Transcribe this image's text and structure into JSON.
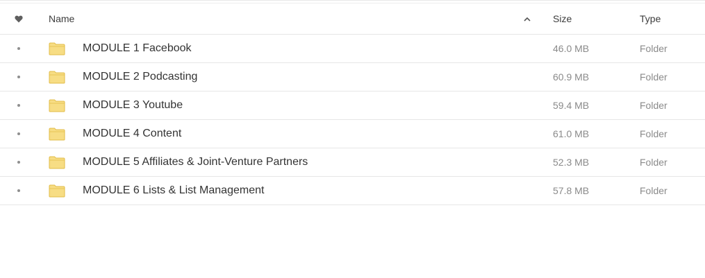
{
  "header": {
    "favorite_icon": "heart-icon",
    "name_label": "Name",
    "sort_icon": "chevron-up-icon",
    "size_label": "Size",
    "type_label": "Type"
  },
  "rows": [
    {
      "name": "MODULE 1 Facebook",
      "size": "46.0 MB",
      "type": "Folder"
    },
    {
      "name": "MODULE 2 Podcasting",
      "size": "60.9 MB",
      "type": "Folder"
    },
    {
      "name": "MODULE 3 Youtube",
      "size": "59.4 MB",
      "type": "Folder"
    },
    {
      "name": "MODULE 4 Content",
      "size": "61.0 MB",
      "type": "Folder"
    },
    {
      "name": "MODULE 5 Affiliates & Joint-Venture Partners",
      "size": "52.3 MB",
      "type": "Folder"
    },
    {
      "name": "MODULE 6 Lists & List Management",
      "size": "57.8 MB",
      "type": "Folder"
    }
  ],
  "colors": {
    "folder_fill": "#f7dd84",
    "folder_stroke": "#e2bc47",
    "accent_text": "#333333",
    "muted_text": "#8a8a8a"
  }
}
